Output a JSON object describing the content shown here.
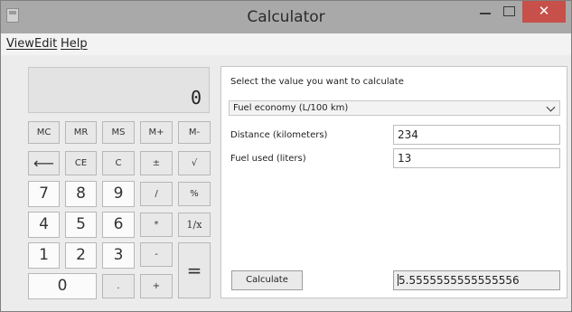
{
  "window": {
    "title": "Calculator",
    "close_glyph": "✕"
  },
  "menu": [
    "View",
    "Edit",
    "Help"
  ],
  "display": {
    "value": "0"
  },
  "keys": {
    "mem": [
      "MC",
      "MR",
      "MS",
      "M+",
      "M-"
    ],
    "row2": [
      "⟵",
      "CE",
      "C",
      "±",
      "√"
    ],
    "row3": [
      "7",
      "8",
      "9",
      "/",
      "%"
    ],
    "row4": [
      "4",
      "5",
      "6",
      "*",
      "1/x"
    ],
    "row5": [
      "1",
      "2",
      "3",
      "-"
    ],
    "row6": [
      "0",
      ".",
      "+"
    ],
    "equals": "="
  },
  "panel": {
    "prompt": "Select the value you want to calculate",
    "dropdown_value": "Fuel economy (L/100 km)",
    "distance_label": "Distance (kilometers)",
    "distance_value": "234",
    "fuel_label": "Fuel used (liters)",
    "fuel_value": "13",
    "calculate_label": "Calculate",
    "result_value": "5.5555555555555556"
  },
  "colors": {
    "close_button": "#c7504a",
    "titlebar": "#a9a9a9"
  }
}
